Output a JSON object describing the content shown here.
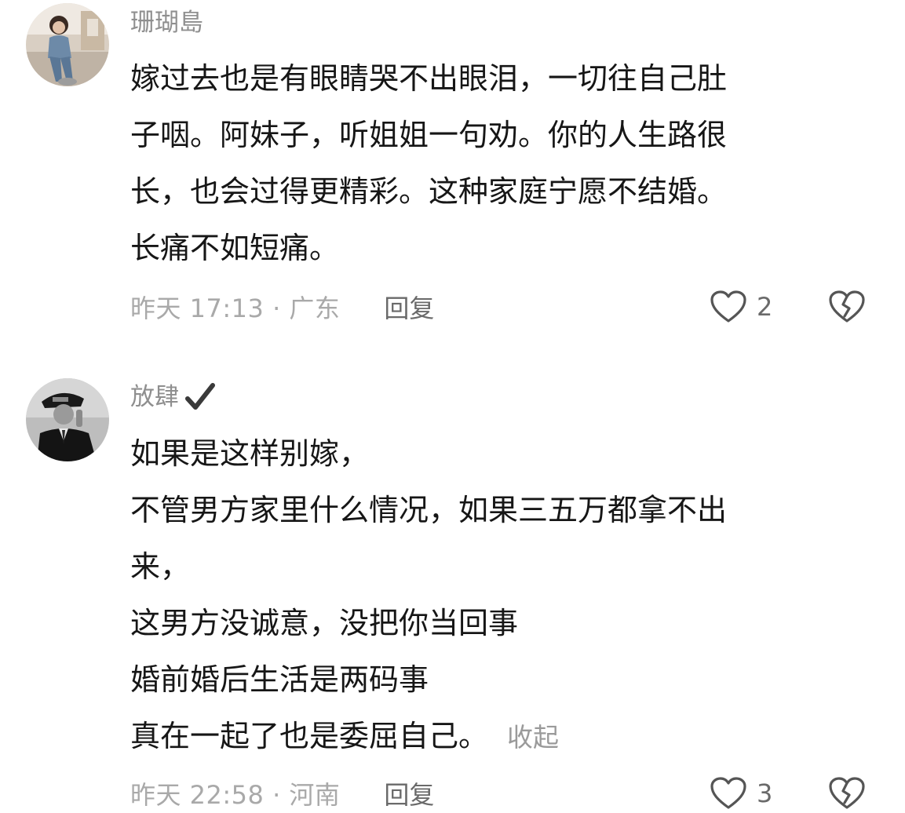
{
  "comments": [
    {
      "username": "珊瑚島",
      "verified": false,
      "lines": [
        "嫁过去也是有眼睛哭不出眼泪，一切往自己肚",
        "子咽。阿妹子，听姐姐一句劝。你的人生路很",
        "长，也会过得更精彩。这种家庭宁愿不结婚。",
        "长痛不如短痛。"
      ],
      "time_location": "昨天 17:13 · 广东",
      "reply_label": "回复",
      "like_count": "2",
      "like_icon": "heart-outline-icon",
      "dislike_icon": "broken-heart-icon"
    },
    {
      "username": "放肆",
      "verified": true,
      "verified_icon": "checkmark-icon",
      "lines": [
        "如果是这样别嫁，",
        "不管男方家里什么情况，如果三五万都拿不出",
        "来，",
        "这男方没诚意，没把你当回事",
        "婚前婚后生活是两码事",
        "真在一起了也是委屈自己。"
      ],
      "collapse_label": "收起",
      "time_location": "昨天 22:58 · 河南",
      "reply_label": "回复",
      "like_count": "3",
      "like_icon": "heart-outline-icon",
      "dislike_icon": "broken-heart-icon"
    }
  ],
  "colors": {
    "username": "#8f8f8f",
    "body": "#161616",
    "meta": "#a9a9a9",
    "action": "#6a6a6a",
    "icon_stroke": "#555555"
  }
}
